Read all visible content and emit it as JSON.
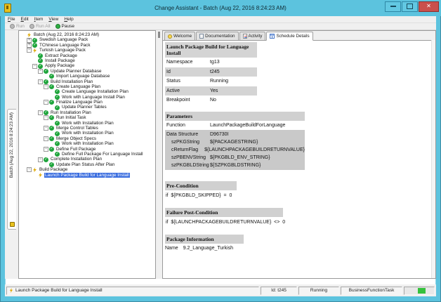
{
  "window": {
    "title": "Change Assistant - Batch (Aug 22, 2016 8:24:23 AM)"
  },
  "colors": {
    "titlebar": "#5cc3de",
    "close_button": "#c9504c",
    "selection_blue": "#3a6ddf",
    "check_green": "#1fa53c",
    "lightning_gold": "#e0a800",
    "row_shade_gray": "#d4d4d4",
    "progress_green": "#35c13d"
  },
  "menu": {
    "items": [
      "File",
      "Edit",
      "Item",
      "View",
      "Help"
    ]
  },
  "toolbar": {
    "buttons": [
      {
        "label": "Run",
        "enabled": false
      },
      {
        "label": "Run All",
        "enabled": false
      },
      {
        "label": "Pause",
        "enabled": true
      }
    ]
  },
  "left_tab": {
    "label": "Batch (Aug 22, 2016 8:24:23 AM)"
  },
  "tree": {
    "items": [
      {
        "label": "Batch (Aug 22, 2016 8:24:23 AM)",
        "lvl": 0,
        "icon": "lightning",
        "handle": null
      },
      {
        "label": "Swedish Language Pack",
        "lvl": 1,
        "icon": "check",
        "handle": "plus"
      },
      {
        "label": "TChinese Language Pack",
        "lvl": 1,
        "icon": "check",
        "handle": "plus"
      },
      {
        "label": "Turkish Language Pack",
        "lvl": 1,
        "icon": "lightning",
        "handle": "minus"
      },
      {
        "label": "Extract Package",
        "lvl": 2,
        "icon": "check",
        "handle": null
      },
      {
        "label": "Install Package",
        "lvl": 2,
        "icon": "check",
        "handle": null
      },
      {
        "label": "Apply Package",
        "lvl": 2,
        "icon": "check",
        "handle": "minus"
      },
      {
        "label": "Update Planner Database",
        "lvl": 3,
        "icon": "check",
        "handle": "minus"
      },
      {
        "label": "Import Language Database",
        "lvl": 4,
        "icon": "check",
        "handle": null
      },
      {
        "label": "Build Installation Plan",
        "lvl": 3,
        "icon": "check",
        "handle": "minus"
      },
      {
        "label": "Create Language Plan",
        "lvl": 4,
        "icon": "check",
        "handle": "minus"
      },
      {
        "label": "Create Language Installation Plan",
        "lvl": 5,
        "icon": "check",
        "handle": null
      },
      {
        "label": "Work with Language Install Plan",
        "lvl": 5,
        "icon": "check",
        "handle": null
      },
      {
        "label": "Finalize Language Plan",
        "lvl": 4,
        "icon": "check",
        "handle": "minus"
      },
      {
        "label": "Update Planner Tables",
        "lvl": 5,
        "icon": "check",
        "handle": null
      },
      {
        "label": "Run Installation Plan",
        "lvl": 3,
        "icon": "check",
        "handle": "minus"
      },
      {
        "label": "Run Initial Task",
        "lvl": 4,
        "icon": "check",
        "handle": "minus"
      },
      {
        "label": "Work with Installation Plan",
        "lvl": 5,
        "icon": "check",
        "handle": null
      },
      {
        "label": "Merge Control Tables",
        "lvl": 4,
        "icon": "check",
        "handle": "minus"
      },
      {
        "label": "Work with Installation Plan",
        "lvl": 5,
        "icon": "check",
        "handle": null
      },
      {
        "label": "Merge Object Specs",
        "lvl": 4,
        "icon": "check",
        "handle": "minus"
      },
      {
        "label": "Work with Installation Plan",
        "lvl": 5,
        "icon": "check",
        "handle": null
      },
      {
        "label": "Define Full Package",
        "lvl": 4,
        "icon": "check",
        "handle": "minus"
      },
      {
        "label": "Define Full Package For Language Install",
        "lvl": 5,
        "icon": "check",
        "handle": null
      },
      {
        "label": "Complete Installation Plan",
        "lvl": 3,
        "icon": "check",
        "handle": "minus"
      },
      {
        "label": "Update Plan Status After Plan",
        "lvl": 4,
        "icon": "check",
        "handle": null
      },
      {
        "label": "Build Package",
        "lvl": 1,
        "icon": "lightning",
        "handle": "minus"
      },
      {
        "label": "Launch Package Build for Language Install",
        "lvl": 2,
        "icon": "lightning",
        "handle": null,
        "selected": true
      }
    ]
  },
  "tabs": [
    {
      "label": "Welcome",
      "icon": "bulb",
      "selected": false
    },
    {
      "label": "Documentation",
      "icon": "doc",
      "selected": false
    },
    {
      "label": "Activity",
      "icon": "activity",
      "selected": false
    },
    {
      "label": "Schedule Details",
      "icon": "grid",
      "selected": true
    }
  ],
  "details": {
    "title": "Launch Package Build for Language Install",
    "fields": [
      {
        "label": "Namespace",
        "value": "tg13"
      },
      {
        "label": "Id",
        "value": "t245"
      },
      {
        "label": "Status",
        "value": "Running"
      },
      {
        "label": "Active",
        "value": "Yes"
      },
      {
        "label": "Breakpoint",
        "value": "No"
      }
    ],
    "parameters": {
      "heading": "Parameters",
      "function_label": "Function",
      "function_value": "LaunchPackageBuildForLanguage",
      "ds_label": "Data Structure",
      "ds_value": "D96730I",
      "params": [
        {
          "label": "szPKGString",
          "value": "${PACKAGESTRING}"
        },
        {
          "label": "cReturnFlag",
          "value": "${LAUNCHPACKAGEBUILDRETURNVALUE}"
        },
        {
          "label": "szPBENVString",
          "value": "${PKGBLD_ENV_STRING}"
        },
        {
          "label": "szPKGBLDString",
          "value": "${SZPKGBLDSTRING}"
        }
      ]
    },
    "pre_condition": {
      "heading": "Pre-Condition",
      "expr": "if  ${PKGBLD_SKIPPED}  =  0"
    },
    "failure_post_condition": {
      "heading": "Failure Post-Condition",
      "expr": "if  ${LAUNCHPACKAGEBUILDRETURNVALUE}  <>  0"
    },
    "package_information": {
      "heading": "Package Information",
      "name_label": "Name",
      "name_value": "9.2_Language_Turkish"
    }
  },
  "statusbar": {
    "message": "Launch Package Build for Language Install",
    "id": "Id: t245",
    "status": "Running",
    "task_type": "BusinessFunctionTask"
  }
}
